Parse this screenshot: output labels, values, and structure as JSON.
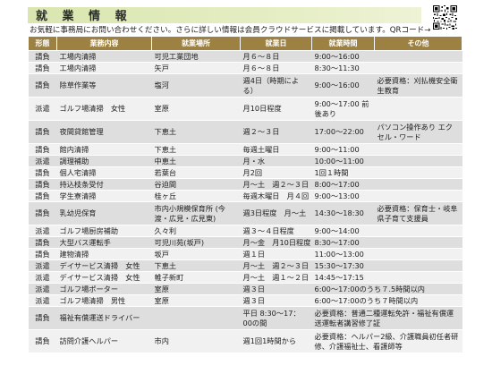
{
  "header": {
    "title": "就 業 情 報",
    "intro": "お気軽に事務局にお問い合わせください。さらに詳しい情報は会員クラウドサービスに掲載しています。QRコード→"
  },
  "table": {
    "columns": [
      "形態",
      "業務内容",
      "就業場所",
      "就業日",
      "就業時間",
      "その他"
    ],
    "rows": [
      {
        "type": "請負",
        "job": "工場内清掃",
        "place": "可児工業団地",
        "days": "月６～８日",
        "hours": "9:00～16:00",
        "other": ""
      },
      {
        "type": "請負",
        "job": "工場内清掃",
        "place": "矢戸",
        "days": "月６～８日",
        "hours": "8:30～11:30",
        "other": ""
      },
      {
        "type": "請負",
        "job": "除草作業等",
        "place": "塩河",
        "days": "週4日（時期による）",
        "hours": "9:00～16:00",
        "other": "必要資格：刈払機安全衛生教育"
      },
      {
        "type": "派遣",
        "job": "ゴルフ場清掃　女性",
        "place": "室原",
        "days": "月10日程度",
        "hours": "9:00～17:00 前後あり",
        "other": ""
      },
      {
        "type": "請負",
        "job": "夜間貸館管理",
        "place": "下恵土",
        "days": "週２～３日",
        "hours": "17:00～22:00",
        "other": "パソコン操作あり エクセル・ワード"
      },
      {
        "type": "請負",
        "job": "館内清掃",
        "place": "下恵土",
        "days": "毎週土曜日",
        "hours": "9:00～11:00",
        "other": ""
      },
      {
        "type": "派遣",
        "job": "調理補助",
        "place": "中恵土",
        "days": "月・水",
        "hours": "10:00～11:00",
        "other": ""
      },
      {
        "type": "請負",
        "job": "個人宅清掃",
        "place": "若葉台",
        "days": "月2回",
        "hours": "1回１時間",
        "other": ""
      },
      {
        "type": "請負",
        "job": "持込枝条受付",
        "place": "谷迫間",
        "days": "月～土　週２～３日",
        "hours": "8:00～17:00",
        "other": ""
      },
      {
        "type": "請負",
        "job": "学生寮清掃",
        "place": "桂ヶ丘",
        "days": "毎週木曜日　月４回",
        "hours": "9:00～13:00",
        "other": ""
      },
      {
        "type": "請負",
        "job": "乳幼児保育",
        "place": "市内小規模保育所 (今渡・広見・広見東)",
        "days": "週3日程度　月～土",
        "hours": "14:30～18:30",
        "other": "必要資格：保育士・岐阜県子育て支援員"
      },
      {
        "type": "派遣",
        "job": "ゴルフ場厨房補助",
        "place": "久々利",
        "days": "週３～４日程度",
        "hours": "9:00～14:00",
        "other": ""
      },
      {
        "type": "請負",
        "job": "大型バス運転手",
        "place": "可児川苑(坂戸)",
        "days": "月～金　月10日程度",
        "hours": "8:30～17:00",
        "other": ""
      },
      {
        "type": "請負",
        "job": "建物清掃",
        "place": "坂戸",
        "days": "週１日",
        "hours": "11:00～13:00",
        "other": ""
      },
      {
        "type": "派遣",
        "job": "デイサービス清掃　女性",
        "place": "下恵土",
        "days": "月～土　週２～３日",
        "hours": "15:30～17:30",
        "other": ""
      },
      {
        "type": "派遣",
        "job": "デイサービス清掃　女性",
        "place": "帷子新町",
        "days": "月～土　週１～２日",
        "hours": "14:45～17:15",
        "other": ""
      },
      {
        "type": "派遣",
        "job": "ゴルフ場ポーター",
        "place": "室原",
        "days": "週３日",
        "hours": "6:00～17:00のうち７.5時間以内",
        "other": ""
      },
      {
        "type": "派遣",
        "job": "ゴルフ場清掃　男性",
        "place": "室原",
        "days": "週３日",
        "hours": "6:00～17:00のうち７時間以内",
        "other": ""
      },
      {
        "type": "請負",
        "job": "福祉有償運送ドライバー",
        "place": "",
        "days": "平日 8:30～17：00の間",
        "hours": "必要資格：普通二種運転免許・福祉有償運送運転者講習修了証",
        "other": ""
      },
      {
        "type": "請負",
        "job": "訪問介護ヘルパー",
        "place": "市内",
        "days": "週1回1時間から",
        "hours": "必要資格：ヘルパー2級、介護職員初任者研修、介護福祉士、看護師等",
        "other": ""
      }
    ]
  }
}
